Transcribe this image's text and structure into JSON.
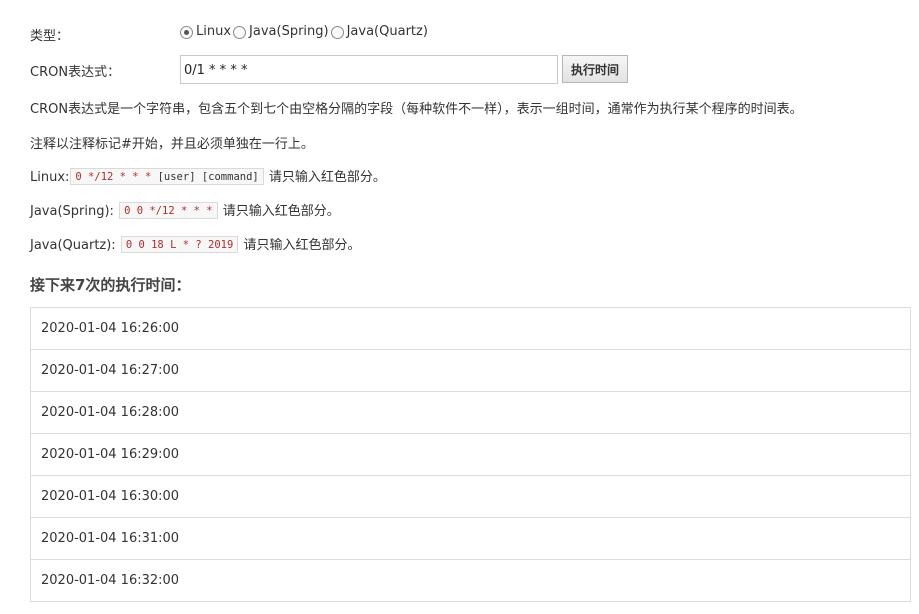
{
  "type_row": {
    "label": "类型：",
    "options": [
      {
        "label": "Linux",
        "checked": true
      },
      {
        "label": "Java(Spring)",
        "checked": false
      },
      {
        "label": "Java(Quartz)",
        "checked": false
      }
    ]
  },
  "cron_row": {
    "label": "CRON表达式：",
    "value": "0/1 * * * *",
    "button_label": "执行时间"
  },
  "description": "CRON表达式是一个字符串，包含五个到七个由空格分隔的字段（每种软件不一样），表示一组时间，通常作为执行某个程序的时间表。",
  "comment_note": "注释以注释标记#开始，并且必须单独在一行上。",
  "examples": {
    "linux": {
      "label": "Linux:",
      "code_red": "0 */12 * * *",
      "code_plain": " [user] [command]",
      "hint": "请只输入红色部分。"
    },
    "spring": {
      "label": "Java(Spring):",
      "code_red": "0 0 */12 * * *",
      "hint": "请只输入红色部分。"
    },
    "quartz": {
      "label": "Java(Quartz):",
      "code_red": "0 0 18 L * ? 2019",
      "hint": "请只输入红色部分。"
    }
  },
  "next_runs": {
    "title": "接下来7次的执行时间：",
    "items": [
      "2020-01-04 16:26:00",
      "2020-01-04 16:27:00",
      "2020-01-04 16:28:00",
      "2020-01-04 16:29:00",
      "2020-01-04 16:30:00",
      "2020-01-04 16:31:00",
      "2020-01-04 16:32:00"
    ]
  },
  "colors": {
    "code_red": "#b52b2b",
    "border": "#dcdcdc",
    "text": "#333333"
  }
}
